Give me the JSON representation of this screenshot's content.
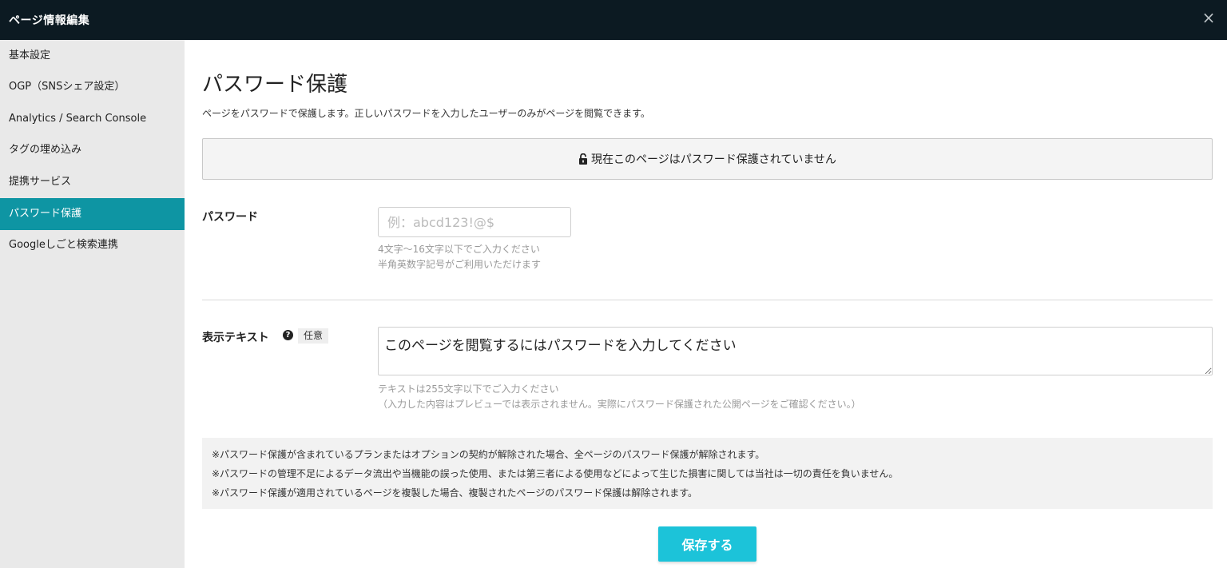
{
  "header": {
    "title": "ページ情報編集",
    "close_icon": "×"
  },
  "sidebar": {
    "items": [
      {
        "label": "基本設定",
        "active": false
      },
      {
        "label": "OGP（SNSシェア設定）",
        "active": false
      },
      {
        "label": "Analytics / Search Console",
        "active": false
      },
      {
        "label": "タグの埋め込み",
        "active": false
      },
      {
        "label": "提携サービス",
        "active": false
      },
      {
        "label": "パスワード保護",
        "active": true
      },
      {
        "label": "Googleしごと検索連携",
        "active": false
      }
    ]
  },
  "main": {
    "title": "パスワード保護",
    "description": "ページをパスワードで保護します。正しいパスワードを入力したユーザーのみがページを閲覧できます。",
    "status": {
      "icon": "unlocked-lock-icon",
      "text": "現在このページはパスワード保護されていません"
    },
    "password": {
      "label": "パスワード",
      "value": "",
      "placeholder": "例：abcd123!@$",
      "hint1": "4文字〜16文字以下でご入力ください",
      "hint2": "半角英数字記号がご利用いただけます"
    },
    "display_text": {
      "label": "表示テキスト",
      "help_icon": "?",
      "optional_badge": "任意",
      "value": "このページを閲覧するにはパスワードを入力してください",
      "hint1": "テキストは255文字以下でご入力ください",
      "hint2": "（入力した内容はプレビューでは表示されません。実際にパスワード保護された公開ページをご確認ください。）"
    },
    "notes": [
      "※パスワード保護が含まれているプランまたはオプションの契約が解除された場合、全ページのパスワード保護が解除されます。",
      "※パスワードの管理不足によるデータ流出や当機能の誤った使用、または第三者による使用などによって生じた損害に関しては当社は一切の責任を負いません。",
      "※パスワード保護が適用されているページを複製した場合、複製されたページのパスワード保護は解除されます。"
    ],
    "save_label": "保存する"
  },
  "colors": {
    "topbar": "#0c1a22",
    "sidebar_bg": "#e9e9e9",
    "active": "#0e95a3",
    "save_button": "#1cc3d9"
  }
}
